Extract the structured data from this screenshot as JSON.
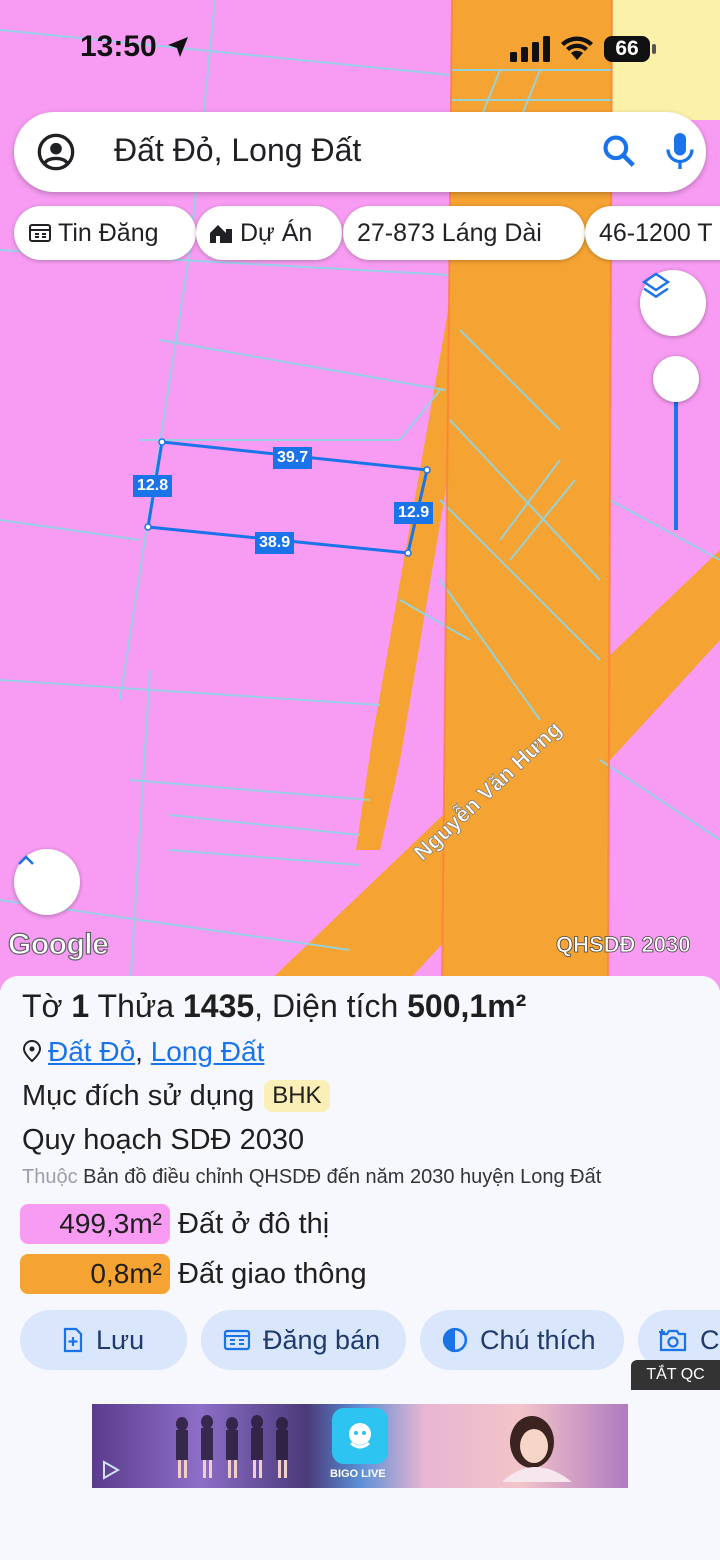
{
  "status": {
    "time": "13:50",
    "battery": "66"
  },
  "search": {
    "query": "Đất Đỏ, Long Đất"
  },
  "chips": [
    {
      "label": "Tin Đăng",
      "icon": "listing-icon"
    },
    {
      "label": "Dự Án",
      "icon": "project-icon"
    },
    {
      "label": "27-873 Láng Dài",
      "icon": ""
    },
    {
      "label": "46-1200 T",
      "icon": ""
    }
  ],
  "map": {
    "dimensions": {
      "top": "39.7",
      "bottom": "38.9",
      "left": "12.8",
      "right": "12.9"
    },
    "road_name": "Nguyễn Văn Hưng",
    "attribution": "Google",
    "plan_label": "QHSDĐ 2030",
    "colors": {
      "residential": "#f79cf2",
      "transport": "#f5a332",
      "parcel_outline": "#1a73e8"
    }
  },
  "parcel": {
    "title_prefix": "Tờ",
    "sheet_no": "1",
    "plot_word": "Thửa",
    "plot_no": "1435",
    "area_label": ", Diện tích",
    "area_value": "500,1m²",
    "commune": "Đất Đỏ",
    "separator": ",",
    "district": "Long Đất",
    "purpose_label": "Mục đích sử dụng",
    "purpose_code": "BHK",
    "plan_title": "Quy hoạch SDĐ 2030",
    "source_prefix": "Thuộc",
    "source_text": "Bản đồ điều chỉnh QHSDĐ đến năm 2030 huyện Long Đất",
    "land_uses": [
      {
        "area": "499,3m²",
        "name": "Đất ở đô thị",
        "color": "#f79cf2"
      },
      {
        "area": "0,8m²",
        "name": "Đất giao thông",
        "color": "#f5a332"
      }
    ]
  },
  "actions": [
    {
      "label": "Lưu",
      "icon": "save-icon"
    },
    {
      "label": "Đăng bán",
      "icon": "post-sale-icon"
    },
    {
      "label": "Chú thích",
      "icon": "legend-icon"
    },
    {
      "label": "C",
      "icon": "camera-icon"
    }
  ],
  "ad": {
    "close_label": "TẮT QC",
    "brand": "BIGO LIVE"
  }
}
